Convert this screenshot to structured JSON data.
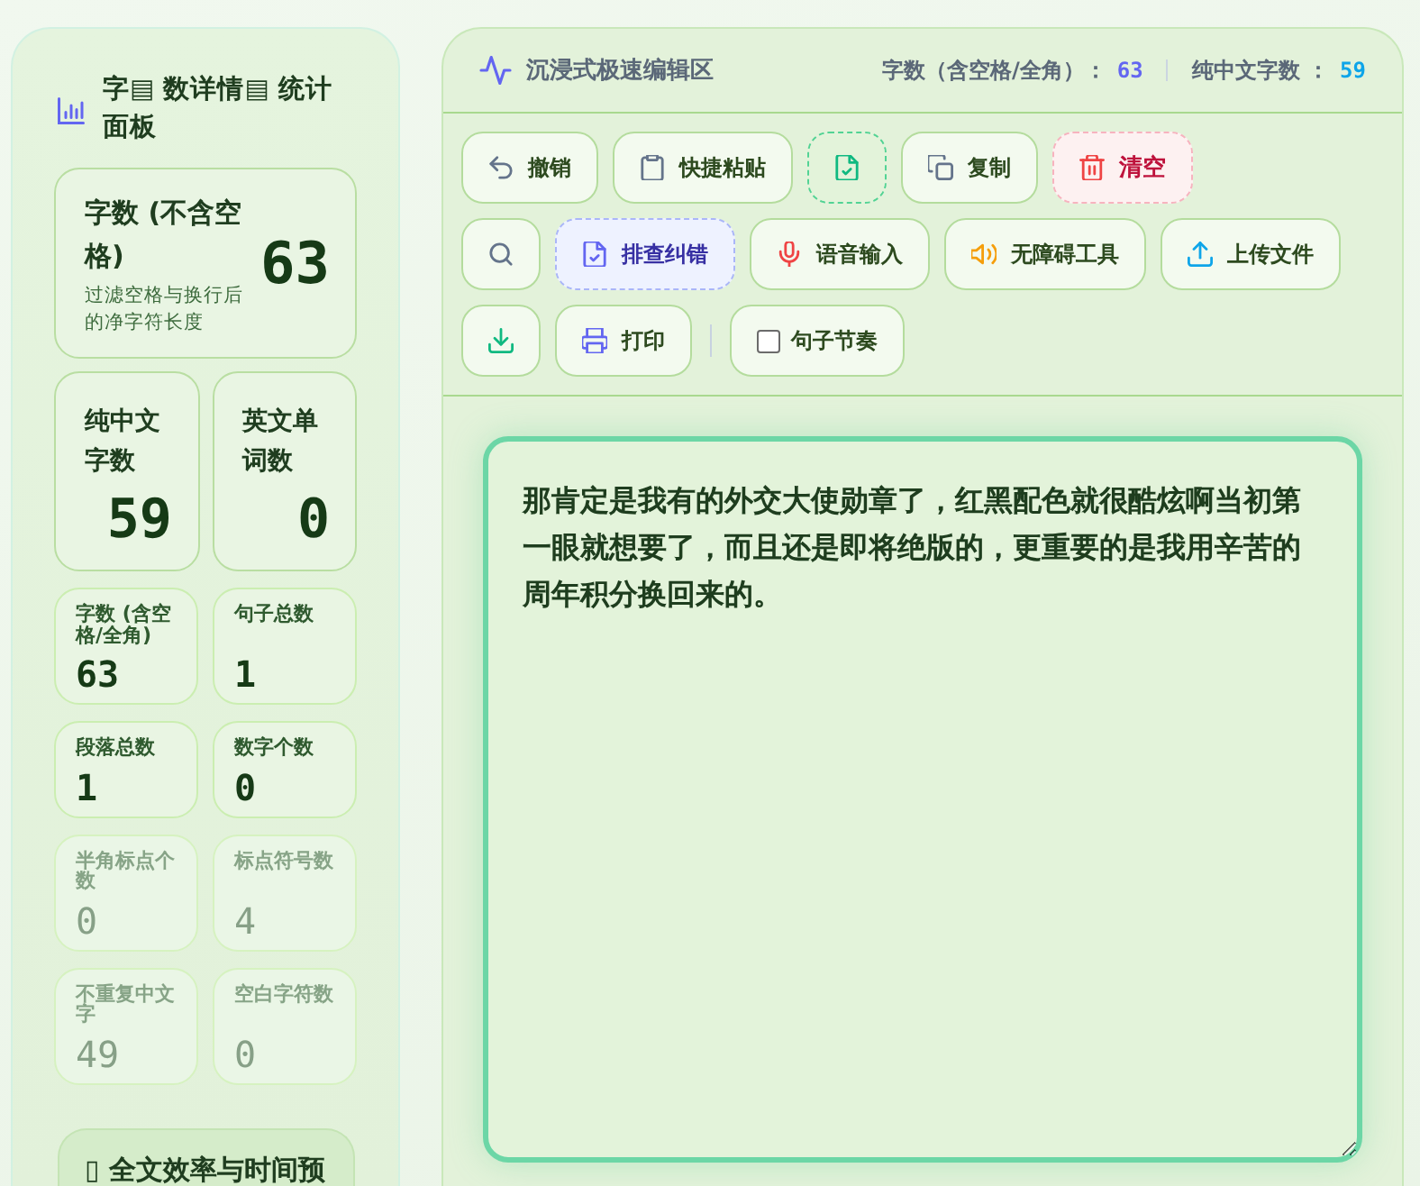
{
  "sidebar": {
    "title": "字▤ 数详情▤ 统计面板",
    "hero": {
      "label": "字数 (不含空格)",
      "note": "过滤空格与换行后的净字符长度",
      "value": "63"
    },
    "pair": [
      {
        "label": "纯中文字数",
        "value": "59"
      },
      {
        "label": "英文单词数",
        "value": "0"
      }
    ],
    "stats": [
      {
        "label": "字数 (含空格/全角)",
        "value": "63",
        "dimmed": false
      },
      {
        "label": "句子总数",
        "value": "1",
        "dimmed": false
      },
      {
        "label": "段落总数",
        "value": "1",
        "dimmed": false
      },
      {
        "label": "数字个数",
        "value": "0",
        "dimmed": false
      },
      {
        "label": "半角标点个数",
        "value": "0",
        "dimmed": true
      },
      {
        "label": "标点符号数",
        "value": "4",
        "dimmed": true
      },
      {
        "label": "不重复中文字",
        "value": "49",
        "dimmed": true
      },
      {
        "label": "空白字符数",
        "value": "0",
        "dimmed": true
      }
    ],
    "section": {
      "title": "▯ 全文效率与时间预"
    }
  },
  "editor": {
    "title": "沉浸式极速编辑区",
    "counts": [
      {
        "label": "字数（含空格/全角）：",
        "value": "63",
        "color": "#6366f1"
      },
      {
        "label": "纯中文字数 ：",
        "value": "59",
        "color": "#0ea5e9"
      }
    ],
    "toolbar": [
      [
        {
          "kind": "plain",
          "label": "撤销"
        },
        {
          "kind": "plain",
          "label": "快捷粘贴"
        },
        {
          "kind": "success"
        },
        {
          "kind": "plain",
          "label": "复制"
        },
        {
          "kind": "danger",
          "label": "清空"
        }
      ],
      [
        {
          "kind": "plain"
        },
        {
          "kind": "accent",
          "label": "排查纠错"
        },
        {
          "kind": "plain",
          "label": "语音输入"
        },
        {
          "kind": "plain",
          "label": "无障碍工具"
        },
        {
          "kind": "plain",
          "label": "上传文件"
        }
      ],
      [
        {
          "kind": "plain"
        },
        {
          "kind": "plain",
          "label": "打印"
        },
        {
          "kind": "divider"
        },
        {
          "kind": "toggle",
          "label": "句子节奏",
          "checked": false
        }
      ]
    ],
    "text": {
      "value": "那肯定是我有的外交大使勋章了，红黑配色就很酷炫啊当初第一眼就想要了，而且还是即将绝版的，更重要的是我用辛苦的周年积分换回来的。"
    }
  }
}
